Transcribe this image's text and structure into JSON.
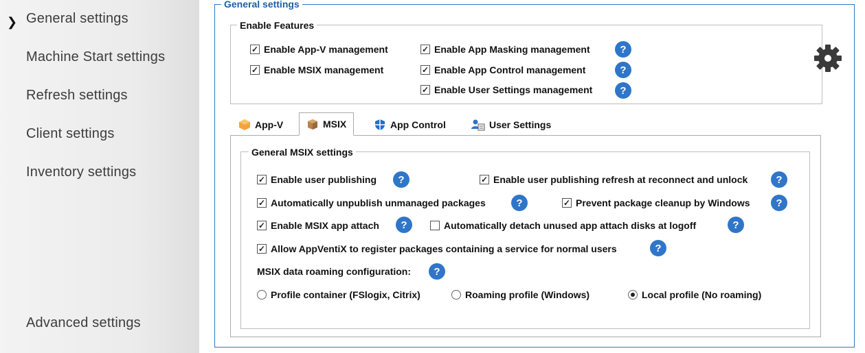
{
  "sidebar": {
    "items": [
      {
        "label": "General settings"
      },
      {
        "label": "Machine Start settings"
      },
      {
        "label": "Refresh settings"
      },
      {
        "label": "Client settings"
      },
      {
        "label": "Inventory settings"
      },
      {
        "label": "Advanced settings"
      }
    ]
  },
  "general": {
    "title": "General settings",
    "features_title": "Enable Features",
    "features": {
      "appv": "Enable App-V management",
      "msix": "Enable MSIX management",
      "masking": "Enable App Masking management",
      "control": "Enable App Control management",
      "user_settings": "Enable User Settings management"
    }
  },
  "tabs": [
    {
      "label": "App-V"
    },
    {
      "label": "MSIX"
    },
    {
      "label": "App Control"
    },
    {
      "label": "User Settings"
    }
  ],
  "msix": {
    "group_title": "General MSIX settings",
    "enable_user_publishing": "Enable user publishing",
    "refresh_reconnect": "Enable user publishing refresh at reconnect and unlock",
    "auto_unpublish": "Automatically unpublish unmanaged packages",
    "prevent_cleanup": "Prevent package cleanup by Windows",
    "app_attach": "Enable MSIX app attach",
    "auto_detach": "Automatically detach unused app attach disks at logoff",
    "allow_register": "Allow AppVentiX to register packages containing a service for normal users",
    "roaming_label": "MSIX data roaming configuration:",
    "roaming_options": {
      "profile_container": "Profile container (FSlogix, Citrix)",
      "roaming_profile": "Roaming profile (Windows)",
      "local_profile": "Local profile (No roaming)"
    }
  },
  "help_glyph": "?",
  "check_glyph": "✓",
  "colors": {
    "accent": "#2a78c8",
    "help": "#2f76c9"
  }
}
